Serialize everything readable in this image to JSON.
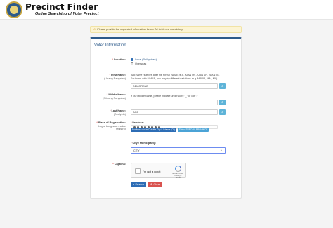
{
  "header": {
    "title": "Precinct Finder",
    "subtitle": "Online Searching of Voter Precinct"
  },
  "alert": {
    "icon": "warning-icon",
    "text": "Please provide the requested information below. All fields are mandatory."
  },
  "card": {
    "title": "Voter Information",
    "location": {
      "label": "Location:",
      "options": [
        "Local (Philippines)",
        "Overseas"
      ],
      "selected": "Local (Philippines)"
    },
    "first_name": {
      "label": "First Name:",
      "sublabel": "(Unang Pangalan)",
      "hint": "Add name (suffixes after the FIRST NAME (e.g. JUAN JR, JUAN SR, JUAN III). For those with MARIA, you may try different variations (e.g. MARIA, MA., MA)",
      "value": "DEMOREAD"
    },
    "middle_name": {
      "label": "Middle Name:",
      "sublabel": "(Gitnang Pangalan)",
      "hint": "If NO Middle Name, please indicate underscore \"_\" or dot \".\"",
      "value": ""
    },
    "last_name": {
      "label": "Last Name:",
      "sublabel": "(Apelyido)",
      "value": "BOE"
    },
    "place_of_registration": {
      "label": "Place of Registration:",
      "sublabel": "(Lugar kung saan naka-rehistro)",
      "province_label": "Province:",
      "tabs": [
        "For those not in Outside City & Islands (OI)",
        "Select SPECIAL PROVINCE"
      ],
      "city_label": "City / Municipality:",
      "city_value": "CITY"
    },
    "captcha": {
      "label": "Captcha:",
      "text": "I'm not a robot",
      "brand": "reCAPTCHA",
      "privacy": "Privacy - Terms"
    },
    "buttons": {
      "search": "Search",
      "clear": "Clear"
    }
  }
}
